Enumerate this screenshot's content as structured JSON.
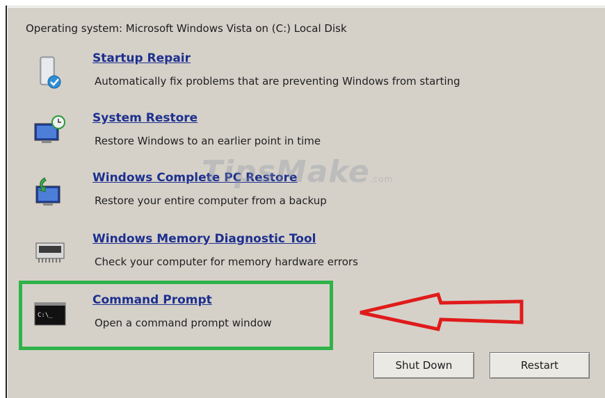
{
  "os_label": "Operating system: Microsoft Windows Vista on (C:) Local Disk",
  "items": [
    {
      "title": "Startup Repair",
      "desc": "Automatically fix problems that are preventing Windows from starting",
      "icon": "startup-repair-icon"
    },
    {
      "title": "System Restore",
      "desc": "Restore Windows to an earlier point in time",
      "icon": "system-restore-icon"
    },
    {
      "title": "Windows Complete PC Restore",
      "desc": "Restore your entire computer from a backup",
      "icon": "pc-restore-icon"
    },
    {
      "title": "Windows Memory Diagnostic Tool",
      "desc": "Check your computer for memory hardware errors",
      "icon": "memory-chip-icon"
    },
    {
      "title": "Command Prompt",
      "desc": "Open a command prompt window",
      "icon": "command-prompt-icon"
    }
  ],
  "cmd_icon_text": "C:\\_",
  "buttons": {
    "shutdown": "Shut Down",
    "restart": "Restart"
  },
  "watermark": {
    "main": "TipsMake",
    "suffix": ".com"
  },
  "colors": {
    "highlight": "#2fb24a",
    "arrow": "#e01b1b",
    "link": "#1d2f8f"
  }
}
